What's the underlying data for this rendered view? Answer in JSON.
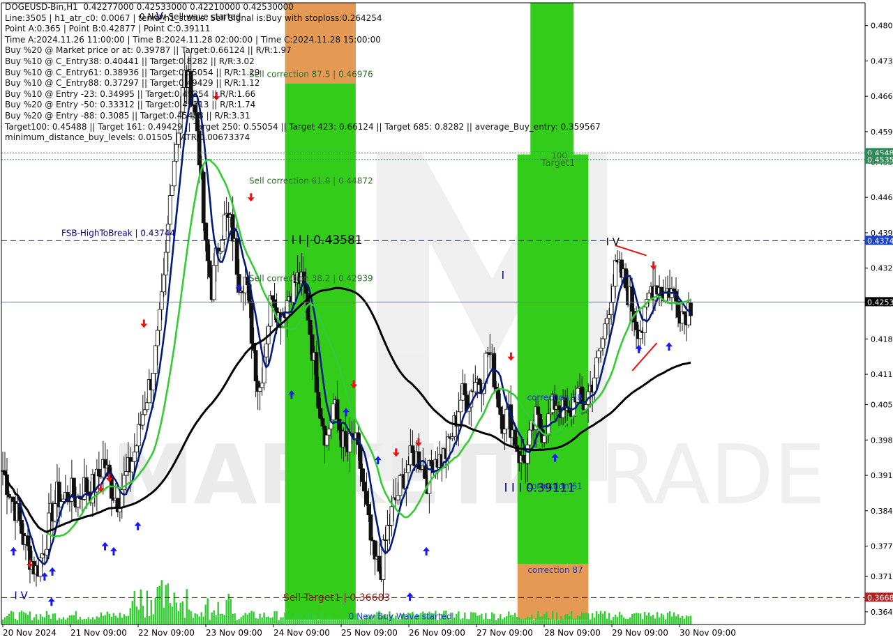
{
  "header": {
    "info_lines": [
      "DOGEUSD-Bin,H1  0.42277000 0.42533000 0.42210000 0.42530000",
      "Line:3505 | h1_atr_c0: 0.0067 | tema_h1_status: Sell Signal is:Buy with stoploss:0.264254",
      "Point A:0.365 | Point B:0.42877 | Point C:0.39111",
      "Time A:2024.11.26 11:00:00 | Time B:2024.11.28 02:00:00 | Time C:2024.11.28 15:00:00",
      "Buy %20 @ Market price or at: 0.39787 || Target:0.66124 || R/R:1.97",
      "Buy %10 @ C_Entry38: 0.40441 || Target:0.8282 || R/R:3.02",
      "Buy %10 @ C_Entry61: 0.38936 || Target:0.55054 || R/R:1.29",
      "Buy %10 @ C_Entry88: 0.37297 || Target:0.49429 || R/R:1.12",
      "Buy %10 @ Entry -23: 0.34995 || Target:0.49254 || R/R:1.66",
      "Buy %20 @ Entry -50: 0.33312 || Target:0.45313 || R/R:1.74",
      "Buy %20 @ Entry -88: 0.3085 || Target:0.45488 || R/R:3.31",
      "Target100: 0.45488 || Target 161: 0.49429 || Target 250: 0.55054 || Target 423: 0.66124 || Target 685: 0.8282 || average_Buy_entry: 0.359567",
      "minimum_distance_buy_levels: 0.01505 | ATR:0.00673374"
    ],
    "top_banner": "0 New Sell wave started"
  },
  "chart_data": {
    "type": "candlestick",
    "symbol": "DOGEUSD-Bin",
    "timeframe": "H1",
    "ohlc_header": {
      "open": 0.42277,
      "high": 0.42533,
      "low": 0.4221,
      "close": 0.4253
    },
    "ylim": [
      0.3615,
      0.4845
    ],
    "y_ticks": [
      "0.480",
      "0.473",
      "0.466",
      "0.459",
      "0.453",
      "0.446",
      "0.439",
      "0.432",
      "0.425",
      "0.418",
      "0.411",
      "0.405",
      "0.398",
      "0.391",
      "0.384",
      "0.377",
      "0.371",
      "0.364"
    ],
    "y_tick_values": [
      0.48,
      0.473,
      0.466,
      0.459,
      0.453,
      0.446,
      0.439,
      0.432,
      0.425,
      0.418,
      0.411,
      0.405,
      0.398,
      0.391,
      0.384,
      0.377,
      0.371,
      0.364
    ],
    "x_ticks": [
      "20 Nov 2024",
      "21 Nov 09:00",
      "22 Nov 09:00",
      "23 Nov 09:00",
      "24 Nov 09:00",
      "25 Nov 09:00",
      "26 Nov 09:00",
      "27 Nov 09:00",
      "28 Nov 09:00",
      "29 Nov 09:00",
      "30 Nov 09:00"
    ],
    "price_path": [
      [
        0.392,
        0.388,
        0.384,
        0.379,
        0.375,
        0.372,
        0.376,
        0.382,
        0.387,
        0.386,
        0.388,
        0.386,
        0.389,
        0.388,
        0.39,
        0.394,
        0.389,
        0.386,
        0.39,
        0.393,
        0.398,
        0.405,
        0.41,
        0.418,
        0.43,
        0.45,
        0.46,
        0.47,
        0.467,
        0.458,
        0.436,
        0.428,
        0.437,
        0.442,
        0.44,
        0.43
      ],
      [
        0.43,
        0.418,
        0.407,
        0.418,
        0.428,
        0.422,
        0.425,
        0.429,
        0.43,
        0.426,
        0.415,
        0.405,
        0.398,
        0.405,
        0.4,
        0.395,
        0.399,
        0.393,
        0.383,
        0.374,
        0.372,
        0.38,
        0.385,
        0.389,
        0.393,
        0.395,
        0.394,
        0.39,
        0.395,
        0.394,
        0.396,
        0.401,
        0.407,
        0.406,
        0.41
      ],
      [
        0.41,
        0.416,
        0.41,
        0.402,
        0.403,
        0.398,
        0.393,
        0.397,
        0.402,
        0.4,
        0.402,
        0.406,
        0.404,
        0.402,
        0.408,
        0.404,
        0.408,
        0.412,
        0.418,
        0.426,
        0.432,
        0.43,
        0.426,
        0.421,
        0.42,
        0.428,
        0.429,
        0.427,
        0.428,
        0.425,
        0.423,
        0.425
      ]
    ],
    "moving_averages": [
      {
        "color": "#001a80",
        "role": "ma-short"
      },
      {
        "color": "#33cc33",
        "role": "ma-mid"
      },
      {
        "color": "#000000",
        "role": "ma-long"
      }
    ],
    "bands_color": "#ff5a1e",
    "zones": [
      {
        "x_frac": [
          0.3285,
          0.4102
        ],
        "from": 0.3625,
        "to": 0.4845,
        "color": "#33cc1a",
        "label": "sell-zone-green"
      },
      {
        "x_frac": [
          0.3285,
          0.4102
        ],
        "from": 0.4685,
        "to": 0.4845,
        "color": "#e49a55",
        "label": "sell-zone-orange"
      },
      {
        "x_frac": [
          0.6125,
          0.6625
        ],
        "from": 0.4545,
        "to": 0.4845,
        "color": "#33cc1a",
        "label": "top-green"
      },
      {
        "x_frac": [
          0.5975,
          0.6796
        ],
        "from": 0.3735,
        "to": 0.4545,
        "color": "#33cc1a",
        "label": "buy-zone-green"
      },
      {
        "x_frac": [
          0.5975,
          0.6796
        ],
        "from": 0.3625,
        "to": 0.3735,
        "color": "#e49a55",
        "label": "buy-zone-orange"
      }
    ],
    "hlines": [
      {
        "value": 0.4548,
        "color": "#2e8b57",
        "style": "dotted"
      },
      {
        "value": 0.4535,
        "color": "#2e8b57",
        "style": "dotted"
      },
      {
        "value": 0.43744,
        "color": "#000080",
        "style": "dashed"
      },
      {
        "value": 0.4253,
        "color": "#708090",
        "style": "solid"
      },
      {
        "value": 0.36683,
        "color": "#8b0000",
        "style": "dashed"
      }
    ],
    "price_labels": [
      {
        "text": "0.4548",
        "value": 0.4548,
        "bg": "#2e8b57"
      },
      {
        "text": "0.4535",
        "value": 0.4535,
        "bg": "#2e8b57"
      },
      {
        "text": "0.4374",
        "value": 0.43744,
        "bg": "#1a44cc"
      },
      {
        "text": "0.4253",
        "value": 0.4253,
        "bg": "#000000"
      },
      {
        "text": "0.3668",
        "value": 0.36683,
        "bg": "#b22222"
      }
    ],
    "annotations": [
      {
        "text": "Sell correction 87.5 | 0.46976",
        "x_frac": 0.2868,
        "value": 0.4698,
        "color": "#2f6f2f",
        "size": 12
      },
      {
        "text": "Sell correction 61.8 | 0.44872",
        "x_frac": 0.2868,
        "value": 0.4487,
        "color": "#2f6f2f",
        "size": 12
      },
      {
        "text": "Sell correction 38.2 | 0.42939",
        "x_frac": 0.2868,
        "value": 0.4294,
        "color": "#2f6f2f",
        "size": 12
      },
      {
        "text": "FSB-HighToBreak | 0.43744",
        "x_frac": 0.0695,
        "value": 0.4384,
        "color": "#000080",
        "size": 12
      },
      {
        "text": "I I | 0.43581",
        "x_frac": 0.3355,
        "value": 0.4368,
        "color": "#000000",
        "size": 17
      },
      {
        "text": "100",
        "x_frac": 0.6367,
        "value": 0.4537,
        "color": "#2f6f2f",
        "size": 12
      },
      {
        "text": "Target1",
        "x_frac": 0.625,
        "value": 0.4522,
        "color": "#2f6f2f",
        "size": 13
      },
      {
        "text": "correction 38",
        "x_frac": 0.6086,
        "value": 0.4058,
        "color": "#1a3acc",
        "size": 12
      },
      {
        "text": "correction 61",
        "x_frac": 0.6086,
        "value": 0.3883,
        "color": "#1a3acc",
        "size": 12
      },
      {
        "text": "I I I 0.39111",
        "x_frac": 0.582,
        "value": 0.3878,
        "color": "#000080",
        "size": 17
      },
      {
        "text": "correction 87",
        "x_frac": 0.6093,
        "value": 0.3717,
        "color": "#1a3acc",
        "size": 12
      },
      {
        "text": "Sell Target1 | 0.36683",
        "x_frac": 0.3262,
        "value": 0.3662,
        "color": "#8b1a1a",
        "size": 14
      },
      {
        "text": "0 New Buy Wave started",
        "x_frac": 0.402,
        "value": 0.3625,
        "color": "#1a3acc",
        "size": 12
      },
      {
        "text": "I V",
        "x_frac": 0.7,
        "value": 0.4365,
        "color": "#000000",
        "size": 15
      },
      {
        "text": "I V",
        "x_frac": 0.0148,
        "value": 0.3665,
        "color": "#000080",
        "size": 15
      },
      {
        "text": "V",
        "x_frac": 0.1789,
        "value": 0.4812,
        "color": "#000080",
        "size": 15
      },
      {
        "text": "I",
        "x_frac": 0.5789,
        "value": 0.4299,
        "color": "#000080",
        "size": 15
      }
    ],
    "watermark": "MARKETZITRADE"
  }
}
